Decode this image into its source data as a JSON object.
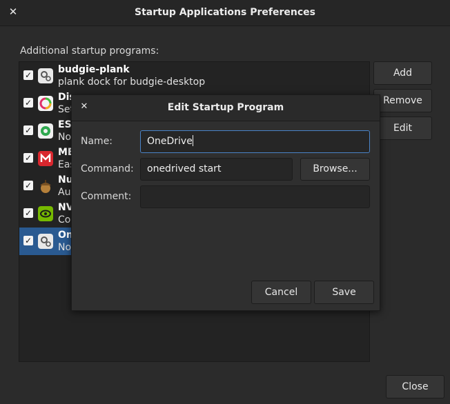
{
  "window": {
    "title": "Startup Applications Preferences",
    "section_label": "Additional startup programs:",
    "close_label": "Close"
  },
  "buttons": {
    "add": "Add",
    "remove": "Remove",
    "edit": "Edit"
  },
  "programs": [
    {
      "name": "budgie-plank",
      "desc": "plank dock for budgie-desktop",
      "icon": "gear-icon",
      "checked": true
    },
    {
      "name": "Dis",
      "desc": "Set",
      "icon": "display-color-icon",
      "checked": true
    },
    {
      "name": "ES",
      "desc": "No",
      "icon": "es-icon",
      "checked": true
    },
    {
      "name": "ME",
      "desc": "Eas",
      "icon": "mega-icon",
      "checked": true
    },
    {
      "name": "Nu",
      "desc": "Au",
      "icon": "acorn-icon",
      "checked": true
    },
    {
      "name": "NV",
      "desc": "Co",
      "icon": "nvidia-icon",
      "checked": true
    },
    {
      "name": "On",
      "desc": "No",
      "icon": "gear-icon",
      "checked": true,
      "selected": true
    }
  ],
  "dialog": {
    "title": "Edit Startup Program",
    "name_label": "Name:",
    "name_value": "OneDrive",
    "command_label": "Command:",
    "command_value": "onedrived start",
    "browse_label": "Browse...",
    "comment_label": "Comment:",
    "comment_value": "",
    "cancel_label": "Cancel",
    "save_label": "Save"
  }
}
